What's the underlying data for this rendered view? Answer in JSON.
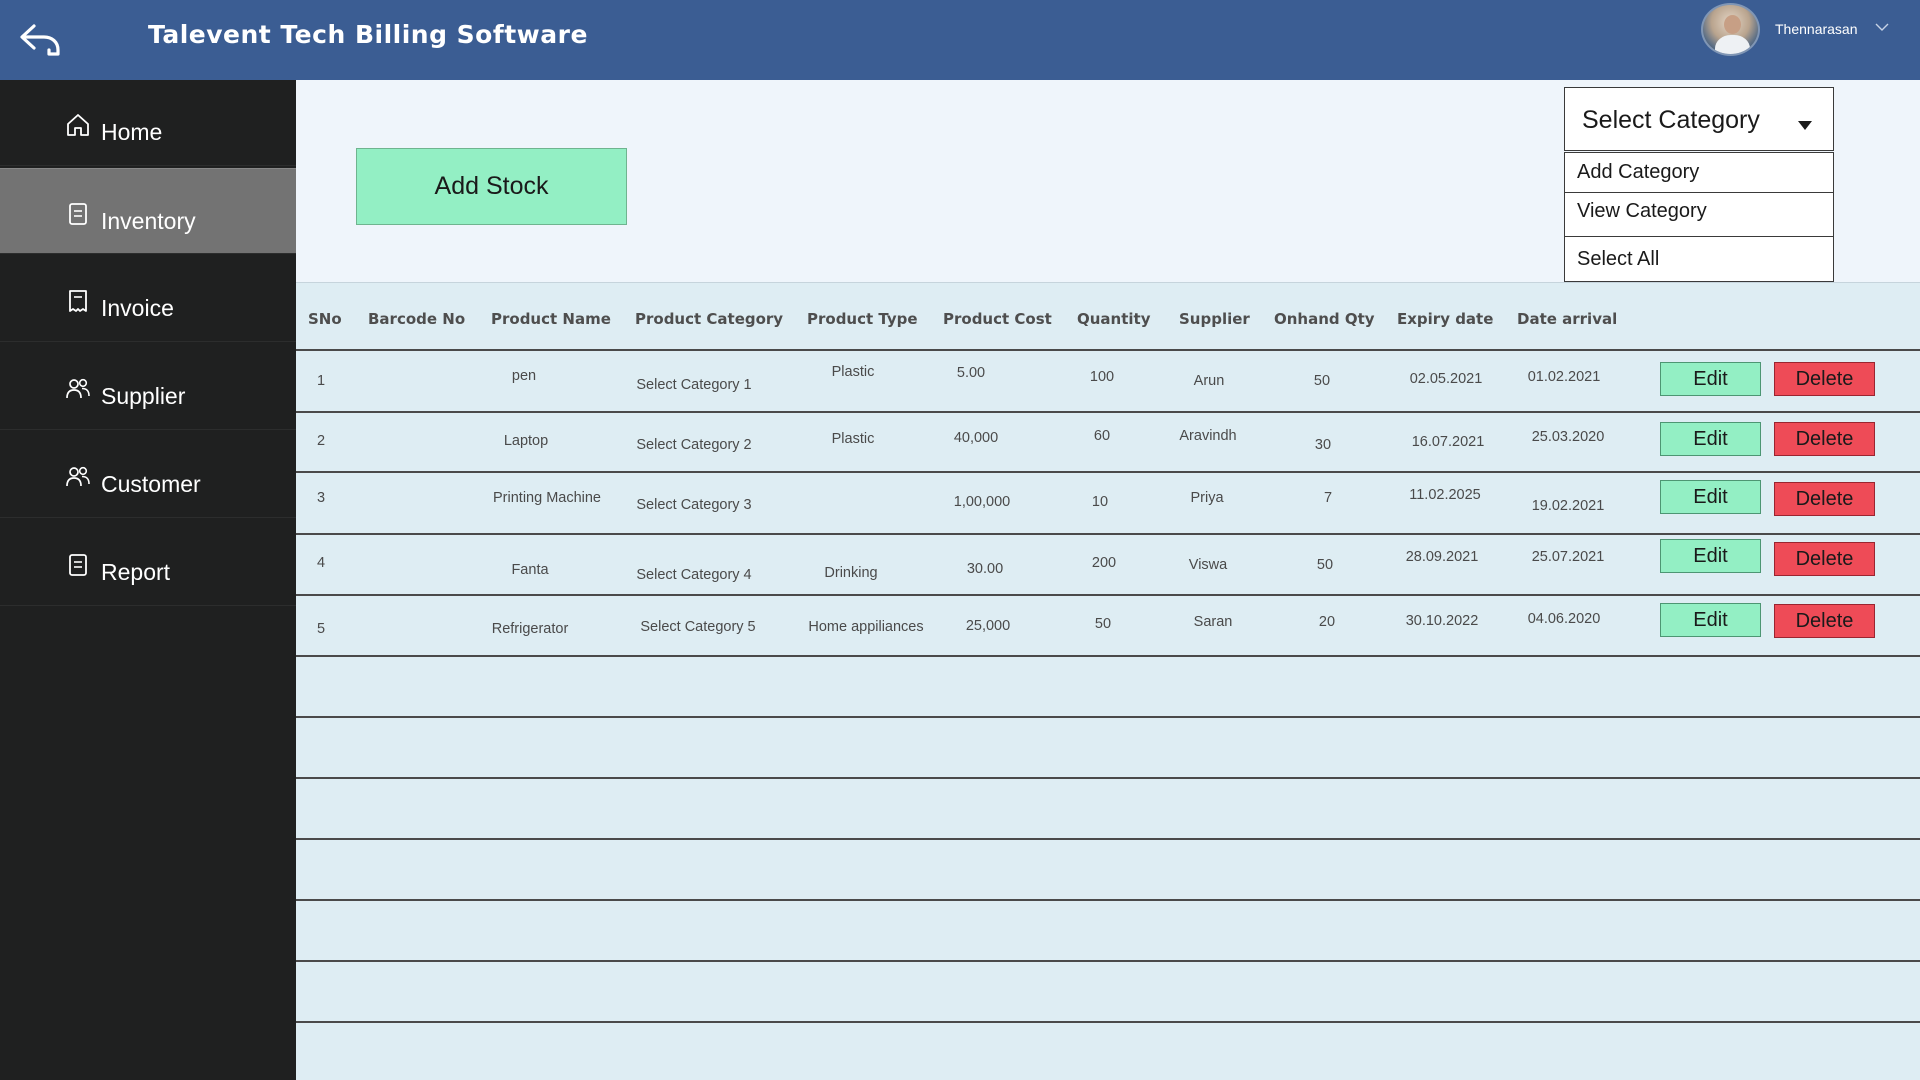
{
  "header": {
    "title": "Talevent Tech Billing Software",
    "user_name": "Thennarasan",
    "back_icon": "back-arrow-icon",
    "menu_icon": "chevron-down-icon"
  },
  "sidebar": {
    "items": [
      {
        "label": "Home",
        "icon": "home-icon",
        "active": false
      },
      {
        "label": "Inventory",
        "icon": "document-icon",
        "active": true
      },
      {
        "label": "Invoice",
        "icon": "receipt-icon",
        "active": false
      },
      {
        "label": "Supplier",
        "icon": "users-icon",
        "active": false
      },
      {
        "label": "Customer",
        "icon": "users-icon",
        "active": false
      },
      {
        "label": "Report",
        "icon": "document-icon",
        "active": false
      }
    ]
  },
  "toolbar": {
    "add_stock_label": "Add Stock",
    "category_select_label": "Select Category",
    "category_options": [
      "Add Category",
      "View Category",
      "Select All"
    ]
  },
  "table": {
    "headers": [
      "SNo",
      "Barcode No",
      "Product Name",
      "Product Category",
      "Product Type",
      "Product Cost",
      "Quantity",
      "Supplier",
      "Onhand Qty",
      "Expiry date",
      "Date arrival"
    ],
    "edit_label": "Edit",
    "delete_label": "Delete",
    "rows": [
      {
        "sno": "1",
        "barcode": "",
        "name": "pen",
        "category": "Select Category 1",
        "type": "Plastic",
        "cost": "5.00",
        "quantity": "100",
        "supplier": "Arun",
        "onhand": "50",
        "expiry": "02.05.2021",
        "arrival": "01.02.2021"
      },
      {
        "sno": "2",
        "barcode": "",
        "name": "Laptop",
        "category": "Select Category 2",
        "type": "Plastic",
        "cost": "40,000",
        "quantity": "60",
        "supplier": "Aravindh",
        "onhand": "30",
        "expiry": "16.07.2021",
        "arrival": "25.03.2020"
      },
      {
        "sno": "3",
        "barcode": "",
        "name": "Printing Machine",
        "category": "Select Category 3",
        "type": "",
        "cost": "1,00,000",
        "quantity": "10",
        "supplier": "Priya",
        "onhand": "7",
        "expiry": "11.02.2025",
        "arrival": "19.02.2021"
      },
      {
        "sno": "4",
        "barcode": "",
        "name": "Fanta",
        "category": "Select Category 4",
        "type": "Drinking",
        "cost": "30.00",
        "quantity": "200",
        "supplier": "Viswa",
        "onhand": "50",
        "expiry": "28.09.2021",
        "arrival": "25.07.2021"
      },
      {
        "sno": "5",
        "barcode": "",
        "name": "Refrigerator",
        "category": "Select Category 5",
        "type": "Home appiliances",
        "cost": "25,000",
        "quantity": "50",
        "supplier": "Saran",
        "onhand": "20",
        "expiry": "30.10.2022",
        "arrival": "04.06.2020"
      }
    ]
  },
  "colors": {
    "header_bg": "#3b5d93",
    "sidebar_bg": "#1f2020",
    "sidebar_active_bg": "#737373",
    "content_bg": "#deedf3",
    "top_panel_bg": "#eff5fb",
    "edit_button": "#93efc4",
    "delete_button": "#ee4b57"
  }
}
